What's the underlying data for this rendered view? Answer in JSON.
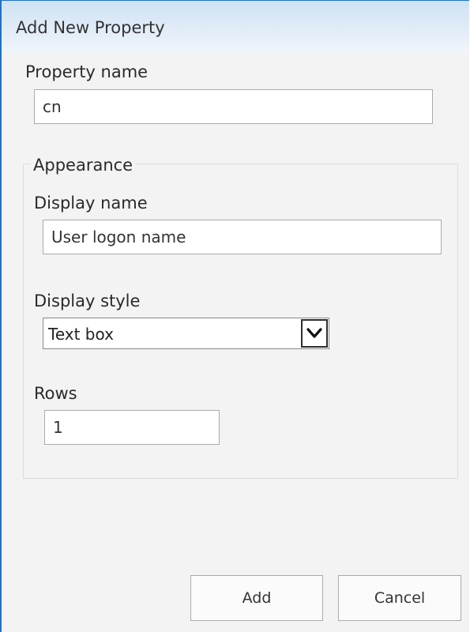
{
  "dialog": {
    "title": "Add New Property"
  },
  "property_name": {
    "label": "Property name",
    "value": "cn"
  },
  "appearance": {
    "legend": "Appearance",
    "display_name": {
      "label": "Display name",
      "value": "User logon name"
    },
    "display_style": {
      "label": "Display style",
      "selected": "Text box"
    },
    "rows": {
      "label": "Rows",
      "value": "1"
    }
  },
  "buttons": {
    "add": "Add",
    "cancel": "Cancel"
  },
  "icons": {
    "dropdown": "chevron-down-icon"
  },
  "colors": {
    "border_accent": "#1f72c4",
    "titlebar": "#d7e6f5",
    "background": "#f3f3f3"
  }
}
